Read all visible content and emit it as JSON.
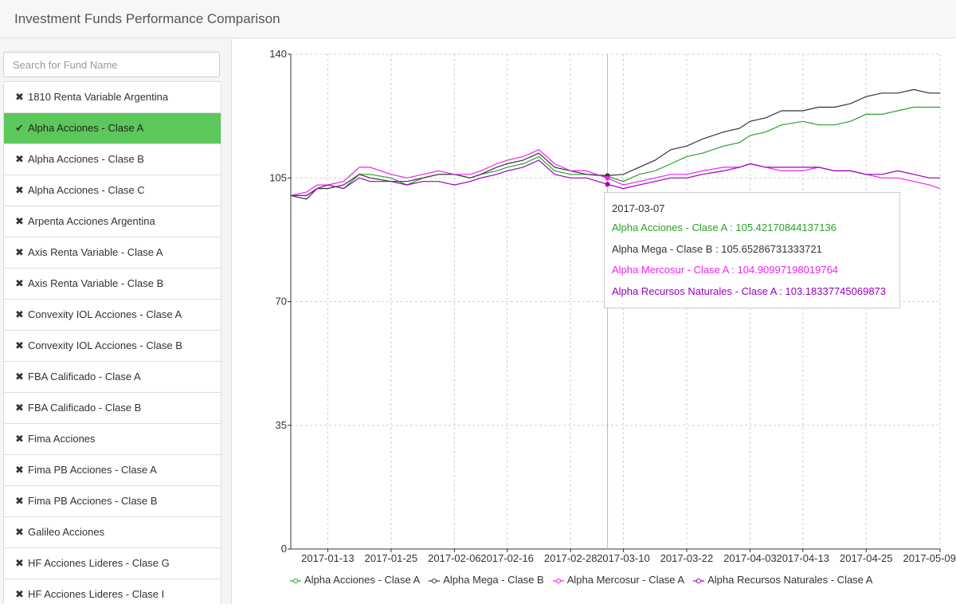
{
  "app": {
    "title": "Investment Funds Performance Comparison"
  },
  "sidebar": {
    "search_placeholder": "Search for Fund Name",
    "funds": [
      {
        "label": "1810 Renta Variable Argentina",
        "selected": false
      },
      {
        "label": "Alpha Acciones - Clase A",
        "selected": true
      },
      {
        "label": "Alpha Acciones - Clase B",
        "selected": false
      },
      {
        "label": "Alpha Acciones - Clase C",
        "selected": false
      },
      {
        "label": "Arpenta Acciones Argentina",
        "selected": false
      },
      {
        "label": "Axis Renta Variable - Clase A",
        "selected": false
      },
      {
        "label": "Axis Renta Variable - Clase B",
        "selected": false
      },
      {
        "label": "Convexity IOL Acciones - Clase A",
        "selected": false
      },
      {
        "label": "Convexity IOL Acciones - Clase B",
        "selected": false
      },
      {
        "label": "FBA Calificado - Clase A",
        "selected": false
      },
      {
        "label": "FBA Calificado - Clase B",
        "selected": false
      },
      {
        "label": "Fima Acciones",
        "selected": false
      },
      {
        "label": "Fima PB Acciones - Clase A",
        "selected": false
      },
      {
        "label": "Fima PB Acciones - Clase B",
        "selected": false
      },
      {
        "label": "Galileo Acciones",
        "selected": false
      },
      {
        "label": "HF Acciones Lideres - Clase G",
        "selected": false
      },
      {
        "label": "HF Acciones Lideres - Clase I",
        "selected": false
      }
    ],
    "icons": {
      "selected": "check-icon",
      "unselected": "x-icon"
    },
    "selected_color": "#5cc85c"
  },
  "chart_data": {
    "type": "line",
    "ylim": [
      0,
      140
    ],
    "yticks": [
      0,
      35,
      70,
      105,
      140
    ],
    "xticks": [
      "2017-01-13",
      "2017-01-25",
      "2017-02-06",
      "2017-02-16",
      "2017-02-28",
      "2017-03-10",
      "2017-03-22",
      "2017-04-03",
      "2017-04-13",
      "2017-04-25",
      "2017-05-09"
    ],
    "grid": true,
    "legend_position": "bottom",
    "x": [
      "2017-01-06",
      "2017-01-09",
      "2017-01-11",
      "2017-01-13",
      "2017-01-16",
      "2017-01-19",
      "2017-01-21",
      "2017-01-25",
      "2017-01-28",
      "2017-01-31",
      "2017-02-03",
      "2017-02-06",
      "2017-02-09",
      "2017-02-11",
      "2017-02-14",
      "2017-02-16",
      "2017-02-19",
      "2017-02-22",
      "2017-02-25",
      "2017-02-28",
      "2017-03-03",
      "2017-03-07",
      "2017-03-10",
      "2017-03-13",
      "2017-03-16",
      "2017-03-19",
      "2017-03-22",
      "2017-03-25",
      "2017-03-29",
      "2017-04-01",
      "2017-04-03",
      "2017-04-06",
      "2017-04-09",
      "2017-04-13",
      "2017-04-16",
      "2017-04-19",
      "2017-04-22",
      "2017-04-25",
      "2017-04-28",
      "2017-05-01",
      "2017-05-04",
      "2017-05-07",
      "2017-05-09"
    ],
    "series": [
      {
        "name": "Alpha Acciones - Clase A",
        "color": "#2ca02c",
        "values": [
          100,
          100,
          102,
          103,
          102,
          106,
          106,
          105,
          103,
          105,
          106,
          106,
          105,
          106,
          107,
          108,
          109,
          111,
          107,
          106,
          106,
          105.4217,
          104,
          106,
          107,
          109,
          111,
          112,
          114,
          115,
          117,
          118,
          120,
          121,
          120,
          120,
          121,
          123,
          123,
          124,
          125,
          125,
          125
        ]
      },
      {
        "name": "Alpha Mega - Clase B",
        "color": "#333333",
        "values": [
          100,
          99,
          102,
          102,
          103,
          106,
          105,
          104,
          104,
          105,
          106,
          106,
          105,
          106,
          108,
          109,
          110,
          112,
          108,
          107,
          106,
          105.6529,
          106,
          108,
          110,
          113,
          114,
          116,
          118,
          119,
          121,
          122,
          124,
          124,
          125,
          125,
          126,
          128,
          129,
          129,
          130,
          129,
          129
        ]
      },
      {
        "name": "Alpha Mercosur - Clase A",
        "color": "#ee22ee",
        "values": [
          100,
          101,
          103,
          103,
          104,
          108,
          108,
          106,
          105,
          106,
          107,
          106,
          106,
          107,
          109,
          110,
          111,
          113,
          109,
          107,
          107,
          104.91,
          103,
          104,
          105,
          106,
          106,
          107,
          108,
          108,
          109,
          108,
          107,
          107,
          108,
          107,
          107,
          106,
          105,
          105,
          104,
          103,
          102
        ]
      },
      {
        "name": "Alpha Recursos Naturales - Clase A",
        "color": "#9900bb",
        "values": [
          100,
          100,
          102,
          103,
          102,
          105,
          104,
          104,
          103,
          104,
          104,
          103,
          104,
          105,
          106,
          107,
          108,
          110,
          106,
          105,
          105,
          103.1834,
          102,
          103,
          104,
          105,
          105,
          106,
          107,
          108,
          109,
          108,
          108,
          108,
          108,
          107,
          107,
          106,
          106,
          107,
          106,
          105,
          105
        ]
      }
    ],
    "tooltip": {
      "date": "2017-03-07",
      "rows": [
        {
          "text": "Alpha Acciones - Clase A : 105.42170844137136",
          "color": "#2ca02c"
        },
        {
          "text": "Alpha Mega - Clase B : 105.65286731333721",
          "color": "#333333"
        },
        {
          "text": "Alpha Mercosur - Clase A : 104.90997198019764",
          "color": "#ee22ee"
        },
        {
          "text": "Alpha Recursos Naturales - Clase A : 103.18337745069873",
          "color": "#9900bb"
        }
      ]
    },
    "hover_date": "2017-03-07"
  }
}
